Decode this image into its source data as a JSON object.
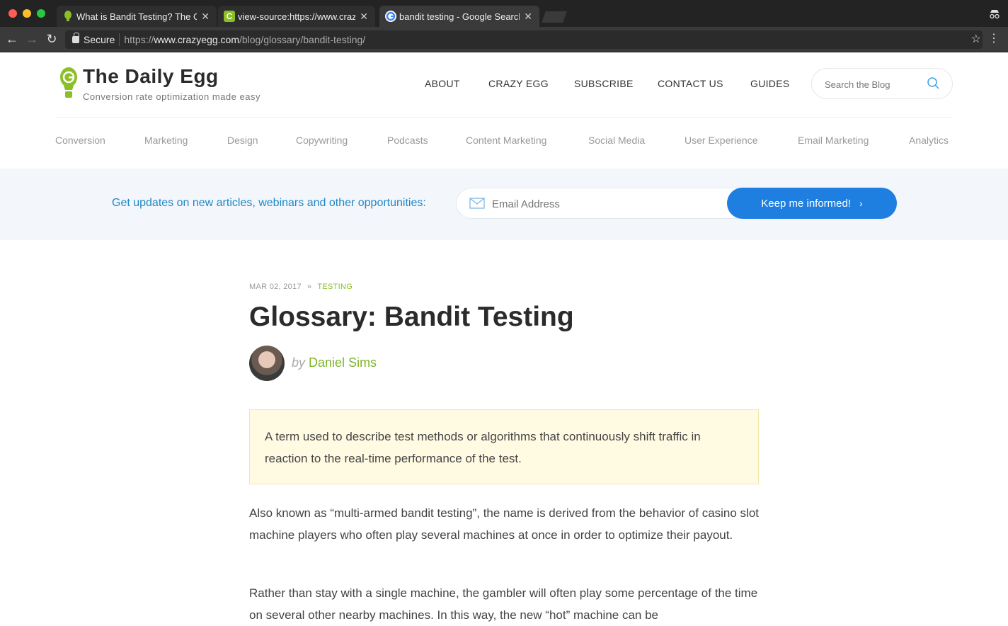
{
  "browser": {
    "tabs": [
      {
        "label": "What is Bandit Testing? The Crazy Egg",
        "favicon_color": "#8cbf26"
      },
      {
        "label": "view-source:https://www.crazyegg.com",
        "favicon_color": "#8cbf26"
      },
      {
        "label": "bandit testing - Google Search",
        "favicon_color": "#4285f4"
      }
    ],
    "secure_label": "Secure",
    "url_scheme": "https://",
    "url_host": "www.crazyegg.com",
    "url_path": "/blog/glossary/bandit-testing/"
  },
  "site": {
    "title": "The Daily Egg",
    "tagline": "Conversion rate optimization made easy",
    "brand_color": "#8cbf26",
    "nav": [
      "ABOUT",
      "CRAZY EGG",
      "SUBSCRIBE",
      "CONTACT US",
      "GUIDES"
    ],
    "search_placeholder": "Search the Blog",
    "categories": [
      "Conversion",
      "Marketing",
      "Design",
      "Copywriting",
      "Podcasts",
      "Content Marketing",
      "Social Media",
      "User Experience",
      "Email Marketing",
      "Analytics"
    ]
  },
  "subscribe": {
    "text": "Get updates on new articles, webinars and other opportunities:",
    "email_placeholder": "Email Address",
    "button_label": "Keep me informed!",
    "button_color": "#1e7fe0"
  },
  "article": {
    "date": "MAR 02, 2017",
    "category": "TESTING",
    "title": "Glossary: Bandit Testing",
    "by": "by",
    "author": "Daniel Sims",
    "definition": "A term used to describe test methods or algorithms that continuously shift traffic in reaction to the real-time performance of the test.",
    "paragraphs": [
      "Also known as “multi-armed bandit testing”, the name is derived from the behavior of casino slot machine players who often play several machines at once in order to optimize their payout.",
      "Rather than stay with a single machine, the gambler will often play some percentage of the time on several other nearby machines. In this way, the new “hot” machine can be"
    ]
  }
}
